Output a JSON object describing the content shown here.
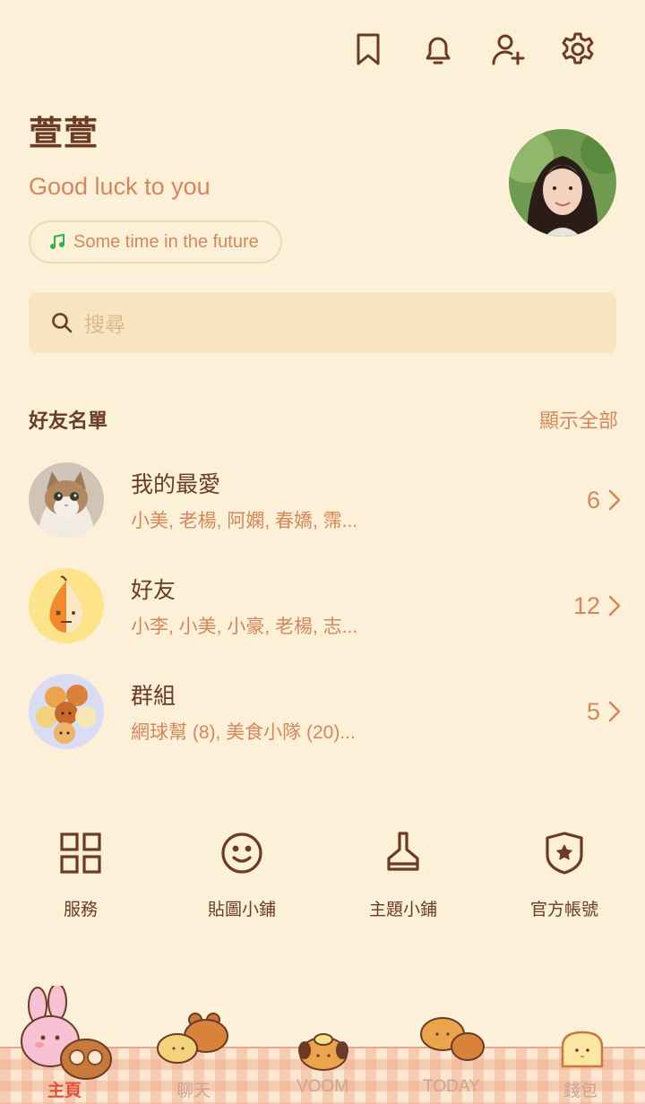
{
  "header": {
    "icons": [
      "bookmark-icon",
      "bell-icon",
      "add-friend-icon",
      "gear-icon"
    ]
  },
  "profile": {
    "name": "萱萱",
    "status_message": "Good luck to you",
    "music": "Some time in the future"
  },
  "search": {
    "placeholder": "搜尋"
  },
  "friends_section": {
    "title": "好友名單",
    "show_all": "顯示全部",
    "groups": [
      {
        "title": "我的最愛",
        "subtitle": "小美, 老楊, 阿嫻, 春嬌, 霈...",
        "count": "6"
      },
      {
        "title": "好友",
        "subtitle": "小李, 小美, 小豪, 老楊, 志...",
        "count": "12"
      },
      {
        "title": "群組",
        "subtitle": "網球幫 (8), 美食小隊 (20)...",
        "count": "5"
      }
    ]
  },
  "services": [
    {
      "label": "服務",
      "icon": "grid-icon"
    },
    {
      "label": "貼圖小鋪",
      "icon": "smiley-icon"
    },
    {
      "label": "主題小鋪",
      "icon": "brush-icon"
    },
    {
      "label": "官方帳號",
      "icon": "shield-star-icon"
    }
  ],
  "tabbar": {
    "tabs": [
      {
        "label": "主頁",
        "active": true
      },
      {
        "label": "聊天",
        "active": false
      },
      {
        "label": "VOOM",
        "active": false
      },
      {
        "label": "TODAY",
        "active": false
      },
      {
        "label": "錢包",
        "active": false
      }
    ]
  },
  "colors": {
    "background": "#fdf0d8",
    "text_primary": "#6b3b26",
    "accent": "#d4875a",
    "search_bg": "#f8e5c0",
    "active_tab": "#e0503a"
  }
}
